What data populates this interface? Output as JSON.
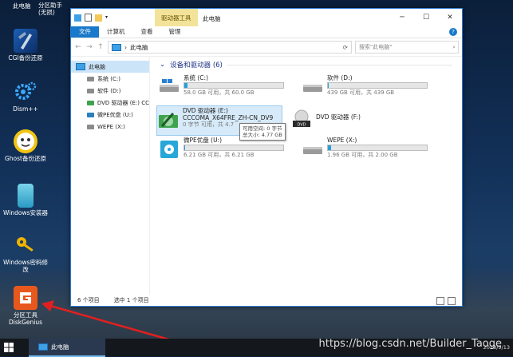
{
  "desktop": {
    "top_labels": [
      "此电脑",
      "分区助手(无损)"
    ],
    "icons": [
      {
        "label": "CGI备份还原"
      },
      {
        "label": "Dism++"
      },
      {
        "label": "Ghost备份还原"
      },
      {
        "label": "Windows安装器"
      },
      {
        "label": "Windows密码修改"
      },
      {
        "label": "分区工具\nDiskGenius"
      }
    ]
  },
  "window": {
    "tool_tab": "驱动器工具",
    "title": "此电脑",
    "ribbon_tabs": [
      "文件",
      "计算机",
      "查看",
      "管理"
    ],
    "address_path": "此电脑",
    "search_placeholder": "搜索\"此电脑\"",
    "sidebar": [
      {
        "label": "此电脑",
        "root": true
      },
      {
        "label": "系统 (C:)"
      },
      {
        "label": "软件 (D:)"
      },
      {
        "label": "DVD 驱动器 (E:) CC"
      },
      {
        "label": "微PE优盘 (U:)"
      },
      {
        "label": "WEPE (X:)"
      }
    ],
    "group_title": "设备和驱动器 (6)",
    "drives": [
      {
        "name": "系统 (C:)",
        "free": "58.0 GB 可用，共 60.0 GB",
        "fill": 0.03
      },
      {
        "name": "软件 (D:)",
        "free": "439 GB 可用，共 439 GB",
        "fill": 0.01
      },
      {
        "name": "DVD 驱动器 (E:)",
        "name2": "CCCOMA_X64FRE_ZH-CN_DV9",
        "free": "0 字节 可用，共 4.7",
        "fill": 0
      },
      {
        "name": "DVD 驱动器 (F:)",
        "free": "",
        "fill": null
      },
      {
        "name": "微PE优盘 (U:)",
        "free": "6.21 GB 可用，共 6.21 GB",
        "fill": 0.01
      },
      {
        "name": "WEPE (X:)",
        "free": "1.96 GB 可用，共 2.00 GB",
        "fill": 0.03
      }
    ],
    "tooltip": [
      "可用空间: 0 字节",
      "总大小: 4.77 GB"
    ],
    "status": {
      "count": "6 个项目",
      "selected": "选中 1 个项目"
    }
  },
  "taskbar": {
    "task": "此电脑",
    "date": "2018/9/13"
  },
  "watermark": "https://blog.csdn.net/Builder_Taoge",
  "colors": {
    "accent": "#1979ca",
    "selection": "#cce4f7",
    "bar_fill": "#26a0da",
    "arrow": "#e02020"
  }
}
